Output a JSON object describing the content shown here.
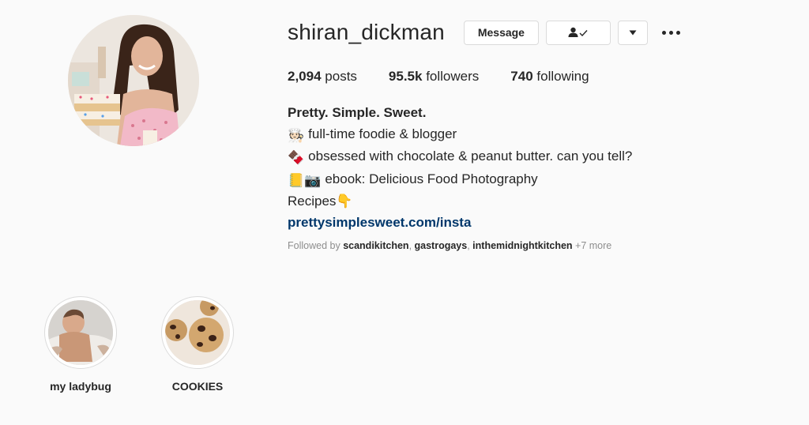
{
  "profile": {
    "username": "shiran_dickman",
    "avatar_icon": "profile-photo"
  },
  "actions": {
    "message_label": "Message",
    "following_icon": "person-check-icon",
    "dropdown_icon": "caret-down-icon",
    "more_icon": "ellipsis-icon"
  },
  "stats": {
    "posts_count": "2,094",
    "posts_label": "posts",
    "followers_count": "95.5k",
    "followers_label": "followers",
    "following_count": "740",
    "following_label": "following"
  },
  "bio": {
    "name": "Pretty. Simple. Sweet.",
    "lines": [
      {
        "emoji": "🧑🏻‍🍳",
        "text": "full-time foodie & blogger"
      },
      {
        "emoji": "🍫",
        "text": "obsessed with chocolate & peanut butter. can you tell?"
      },
      {
        "emoji": "📒📷",
        "text": "ebook: Delicious Food Photography"
      }
    ],
    "recipes_text": "Recipes",
    "recipes_emoji": "👇",
    "link": "prettysimplesweet.com/insta"
  },
  "followed_by": {
    "prefix": "Followed by",
    "accounts": [
      "scandikitchen",
      "gastrogays",
      "inthemidnightkitchen"
    ],
    "more": "+7 more"
  },
  "highlights": [
    {
      "label": "my ladybug"
    },
    {
      "label": "COOKIES"
    }
  ],
  "colors": {
    "background": "#fafafa",
    "text": "#262626",
    "muted": "#8e8e8e",
    "link": "#00376b",
    "border": "#dbdbdb"
  }
}
